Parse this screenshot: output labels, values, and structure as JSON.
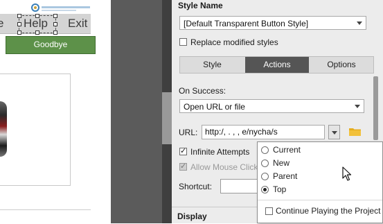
{
  "canvas": {
    "menu": [
      "e",
      "Help",
      "Exit"
    ],
    "goodbye_button": "Goodbye"
  },
  "panel": {
    "style_name_label": "Style Name",
    "style_value": "[Default Transparent Button Style]",
    "replace_modified_label": "Replace modified styles",
    "tabs": [
      "Style",
      "Actions",
      "Options"
    ],
    "active_tab": "Actions",
    "on_success_label": "On Success:",
    "on_success_value": "Open URL or file",
    "url_label": "URL:",
    "url_value": "http:/,          .  ,    ,  e/nycha/s",
    "infinite_attempts_label": "Infinite Attempts",
    "allow_mouse_click_label": "Allow Mouse Click",
    "shortcut_label": "Shortcut:",
    "display_label": "Display"
  },
  "popup": {
    "options": [
      "Current",
      "New",
      "Parent",
      "Top"
    ],
    "selected": "Top",
    "continue_label": "Continue Playing the Project"
  },
  "colors": {
    "accent_tab": "#555555",
    "goodbye_green": "#5d9149",
    "divider_gray": "#5b5b5b",
    "folder_yellow": "#e6ad1d"
  },
  "icons": [
    "chevron-down-icon",
    "folder-icon",
    "mouse-cursor-icon",
    "logo-icon"
  ]
}
